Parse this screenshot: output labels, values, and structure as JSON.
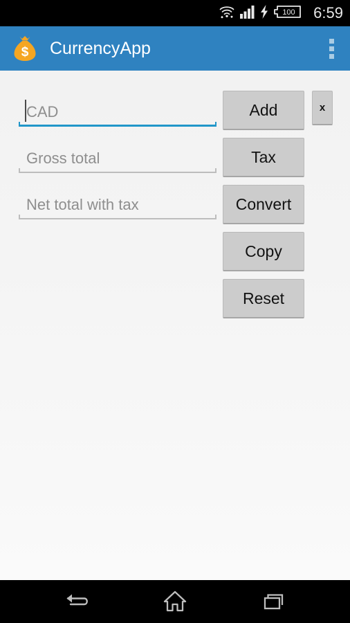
{
  "status_bar": {
    "time": "6:59",
    "battery_level": "100",
    "icons": [
      "wifi-icon",
      "cellular-signal-icon",
      "charging-bolt-icon",
      "battery-icon"
    ]
  },
  "app_bar": {
    "title": "CurrencyApp",
    "logo_icon": "money-bag-icon",
    "overflow_icon": "overflow-menu-icon",
    "background_color": "#2f82c0",
    "title_color": "#ffffff",
    "logo_color": "#f5a623"
  },
  "form": {
    "fields": [
      {
        "name": "currency-input",
        "placeholder": "CAD",
        "value": "",
        "focused": true
      },
      {
        "name": "gross-total-input",
        "placeholder": "Gross total",
        "value": "",
        "focused": false
      },
      {
        "name": "net-total-input",
        "placeholder": "Net total with tax",
        "value": "",
        "focused": false
      }
    ]
  },
  "actions": {
    "add_label": "Add",
    "close_label": "x",
    "tax_label": "Tax",
    "convert_label": "Convert",
    "copy_label": "Copy",
    "reset_label": "Reset"
  },
  "nav_bar": {
    "back_icon": "back-arrow-icon",
    "home_icon": "home-icon",
    "recents_icon": "recent-apps-icon"
  },
  "theme": {
    "accent": "#2196c9",
    "button_face": "#cccccc",
    "content_background": "#f4f4f4",
    "placeholder_text": "#8e8e8e"
  }
}
